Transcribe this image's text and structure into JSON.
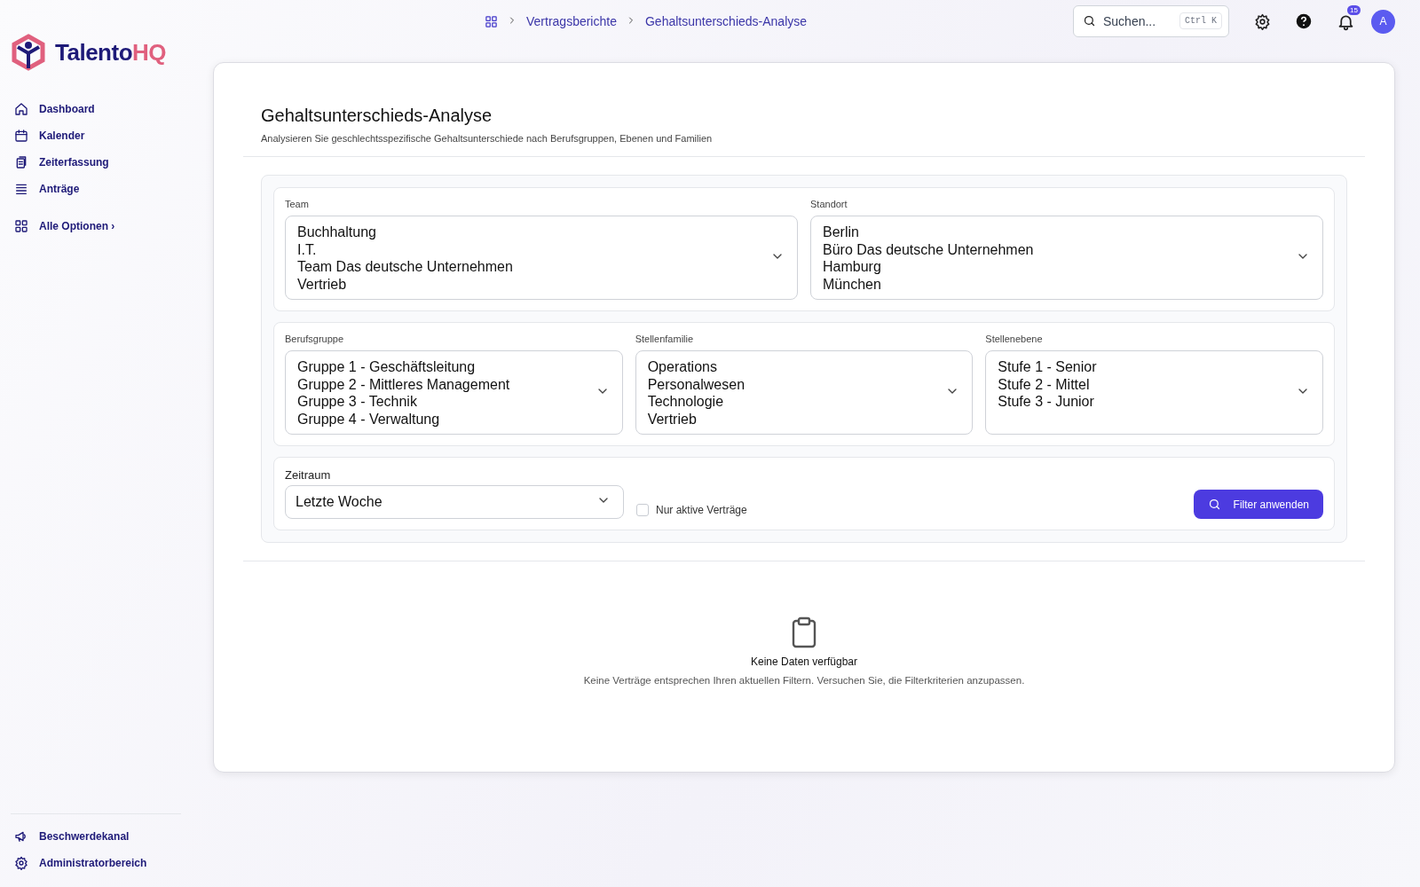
{
  "sidebar": {
    "logo": {
      "part_1": "Talento",
      "part_2": "HQ"
    },
    "items": [
      {
        "label": "Dashboard"
      },
      {
        "label": "Kalender"
      },
      {
        "label": "Zeiterfassung"
      },
      {
        "label": "Anträge"
      }
    ],
    "more": {
      "label": "Alle Optionen",
      "caret": "›"
    },
    "bottom_items": [
      {
        "label": "Beschwerdekanal"
      },
      {
        "label": "Administratorbereich"
      }
    ]
  },
  "breadcrumb": [
    {
      "label": "Vertragsberichte"
    },
    {
      "label": "Gehaltsunterschieds-Analyse"
    }
  ],
  "search": {
    "placeholder": "Suchen...",
    "shortcut": "Ctrl K"
  },
  "notifications": {
    "count": "15"
  },
  "avatar": {
    "initial": "A"
  },
  "page": {
    "title": "Gehaltsunterschieds-Analyse",
    "subtitle": "Analysieren Sie geschlechtsspezifische Gehaltsunterschiede nach Berufsgruppen, Ebenen und Familien"
  },
  "filter_groups": [
    {
      "fields": [
        {
          "label": "Team",
          "options": [
            "Buchhaltung",
            "I.T.",
            "Team Das deutsche Unternehmen",
            "Vertrieb"
          ]
        },
        {
          "label": "Standort",
          "options": [
            "Berlin",
            "Büro Das deutsche Unternehmen",
            "Hamburg",
            "München"
          ]
        }
      ]
    },
    {
      "fields": [
        {
          "label": "Berufsgruppe",
          "options": [
            "Gruppe 1 - Geschäftsleitung",
            "Gruppe 2 - Mittleres Management",
            "Gruppe 3 - Technik",
            "Gruppe 4 - Verwaltung"
          ]
        },
        {
          "label": "Stellenfamilie",
          "options": [
            "Operations",
            "Personalwesen",
            "Technologie",
            "Vertrieb"
          ]
        },
        {
          "label": "Stellenebene",
          "options": [
            "Stufe 1 - Senior",
            "Stufe 2 - Mittel",
            "Stufe 3 - Junior"
          ]
        }
      ]
    }
  ],
  "period": {
    "label": "Zeitraum",
    "value": "Letzte Woche"
  },
  "active_only": {
    "label": "Nur aktive Verträge",
    "checked": false
  },
  "apply_button": {
    "label": "Filter anwenden"
  },
  "empty_state": {
    "title": "Keine Daten verfügbar",
    "message": "Keine Verträge entsprechen Ihren aktuellen Filtern. Versuchen Sie, die Filterkriterien anzupassen."
  }
}
